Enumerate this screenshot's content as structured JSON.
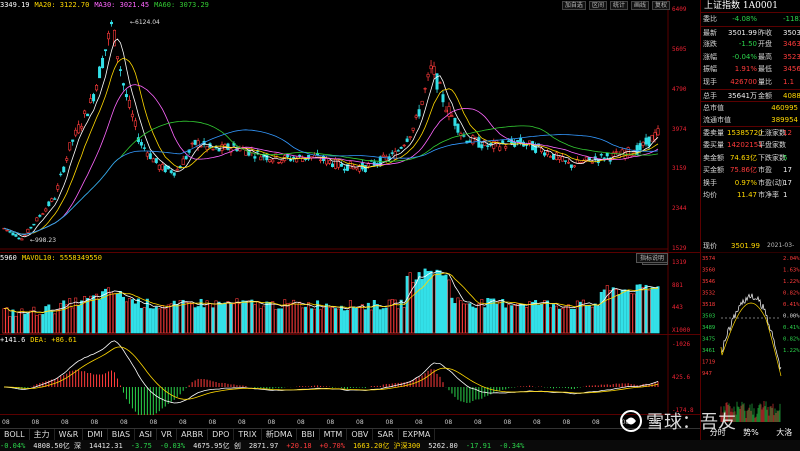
{
  "price_legend": [
    {
      "text": "3349.19",
      "color": "#ffffff"
    },
    {
      "text": "MA20: 3122.70",
      "color": "#ffd800"
    },
    {
      "text": "MA30: 3021.45",
      "color": "#ff66ff"
    },
    {
      "text": "MA60: 3073.29",
      "color": "#33cc33"
    }
  ],
  "toolbar": [
    "加自选",
    "区间",
    "统计",
    "画线",
    "复权"
  ],
  "price_axis": [
    "6409",
    "5605",
    "4790",
    "3974",
    "3159",
    "2344",
    "1529"
  ],
  "price_annotations": {
    "high": "6124.04",
    "low": "998.23"
  },
  "volume_legend": [
    {
      "text": "5960",
      "color": "#ffffff"
    },
    {
      "text": "MAVOL10: 5558349550",
      "color": "#ffd800"
    }
  ],
  "volume_button": "成交量",
  "volume_axis": [
    "1319",
    "881",
    "443",
    "X1000"
  ],
  "macd_legend": [
    {
      "text": "+141.6",
      "color": "#ffffff"
    },
    {
      "text": "DEA: +86.61",
      "color": "#ffd800"
    }
  ],
  "macd_button": "指标说明",
  "macd_axis": [
    "-1026",
    "425.6",
    "-174.8"
  ],
  "tabs": [
    "BOLL",
    "主力",
    "W&R",
    "DMI",
    "BIAS",
    "ASI",
    "VR",
    "ARBR",
    "DPO",
    "TRIX",
    "新DMA",
    "BBI",
    "MTM",
    "OBV",
    "SAR",
    "EXPMA"
  ],
  "x_axis_labels": [
    "08",
    "08",
    "08",
    "08",
    "08",
    "08",
    "08",
    "08",
    "08",
    "08",
    "08",
    "08",
    "08",
    "08",
    "08",
    "08",
    "08",
    "08",
    "08",
    "08",
    "08",
    "08",
    "08"
  ],
  "status_bar": [
    {
      "text": "-0.04%",
      "color": "#2bd34b"
    },
    {
      "text": "4808.50亿 深",
      "color": "#e8e8e8"
    },
    {
      "text": "14412.31",
      "color": "#e8e8e8"
    },
    {
      "text": "-3.75",
      "color": "#2bd34b"
    },
    {
      "text": "-0.03%",
      "color": "#2bd34b"
    },
    {
      "text": "4675.95亿 创",
      "color": "#e8e8e8"
    },
    {
      "text": "2871.97",
      "color": "#e8e8e8"
    },
    {
      "text": "+20.18",
      "color": "#ff3b3b"
    },
    {
      "text": "+0.70%",
      "color": "#ff3b3b"
    },
    {
      "text": "1663.20亿 沪深300",
      "color": "#ffd800"
    },
    {
      "text": "5262.80",
      "color": "#e8e8e8"
    },
    {
      "text": "-17.91",
      "color": "#2bd34b"
    },
    {
      "text": "-0.34%",
      "color": "#2bd34b"
    }
  ],
  "right_panel": {
    "title": "上证指数 1A0001",
    "rows": [
      {
        "label": "委比",
        "v1": "-4.08%",
        "v1_color": "#2bd34b",
        "label2": "",
        "v2": "-11835",
        "v2_color": "#2bd34b"
      },
      {
        "label": "最新",
        "v1": "3501.99",
        "v1_color": "#eeeeee",
        "label2": "昨收",
        "v2": "3503",
        "v2_color": "#eeeeee"
      },
      {
        "label": "涨跌",
        "v1": "-1.50",
        "v1_color": "#2bd34b",
        "label2": "开盘",
        "v2": "3463",
        "v2_color": "#ff3b3b"
      },
      {
        "label": "涨幅",
        "v1": "-0.04%",
        "v1_color": "#2bd34b",
        "label2": "最高",
        "v2": "3523",
        "v2_color": "#ff3b3b"
      },
      {
        "label": "振幅",
        "v1": "1.91%",
        "v1_color": "#ff3b3b",
        "label2": "最低",
        "v2": "3456",
        "v2_color": "#ff3b3b"
      },
      {
        "label": "现手",
        "v1": "426700",
        "v1_color": "#ff3b3b",
        "label2": "量比",
        "v2": "1.1",
        "v2_color": "#ff3b3b"
      },
      {
        "label": "总手",
        "v1": "35641万",
        "v1_color": "#eeeeee",
        "label2": "金额",
        "v2": "4088.50",
        "v2_color": "#ffd800"
      }
    ],
    "rows2": [
      {
        "label": "总市值",
        "value": "460995",
        "color": "#ffd800"
      },
      {
        "label": "流通市值",
        "value": "389954",
        "color": "#ffd800"
      }
    ],
    "rows3": [
      {
        "label": "委卖量",
        "v1": "15385720",
        "v1_color": "#ffd800",
        "label2": "上涨家数",
        "v2": "12",
        "v2_color": "#ff3b3b"
      },
      {
        "label": "委买量",
        "v1": "14202151",
        "v1_color": "#ff3b3b",
        "label2": "平盘家数",
        "v2": "",
        "v2_color": "#eeeeee"
      },
      {
        "label": "卖金额",
        "v1": "74.63亿",
        "v1_color": "#ffd800",
        "label2": "下跌家数",
        "v2": "5",
        "v2_color": "#2bd34b"
      },
      {
        "label": "买金额",
        "v1": "75.86亿",
        "v1_color": "#ff3b3b",
        "label2": "市盈",
        "v2": "17",
        "v2_color": "#eeeeee"
      },
      {
        "label": "换手",
        "v1": "0.97%",
        "v1_color": "#ffd800",
        "label2": "市盈(动)",
        "v2": "17",
        "v2_color": "#eeeeee"
      },
      {
        "label": "均价",
        "v1": "11.47",
        "v1_color": "#ffd800",
        "label2": "市净率",
        "v2": "1",
        "v2_color": "#eeeeee"
      }
    ],
    "current_label": "现价",
    "current_value": "3501.99",
    "current_date": "2021-03-05",
    "mini_left_axis": [
      "3574",
      "3560",
      "3546",
      "3532",
      "3518",
      "3503",
      "3489",
      "3475",
      "3461",
      "1719",
      "947"
    ],
    "mini_right_axis": [
      "2.04%",
      "1.63%",
      "1.22%",
      "0.82%",
      "0.41%",
      "0.00%",
      "0.41%",
      "0.82%",
      "1.22%"
    ],
    "bottom_tabs": [
      "分时",
      "势%",
      "大洛"
    ]
  },
  "watermark": "雪球：吾友",
  "colors": {
    "up": "#ff3b3b",
    "down": "#2bd34b",
    "cyan": "#33e0e8",
    "yellow": "#ffd800",
    "frame": "#5a0000"
  }
}
